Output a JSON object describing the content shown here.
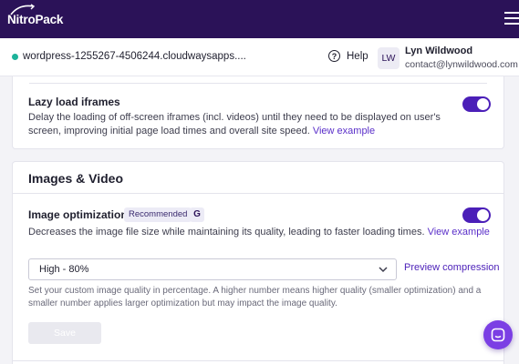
{
  "app": {
    "logo_text": "NitroPack"
  },
  "site": {
    "name": "wordpress-1255267-4506244.cloudwaysapps...."
  },
  "header": {
    "help_label": "Help"
  },
  "user": {
    "initials": "LW",
    "name": "Lyn Wildwood",
    "email": "contact@lynwildwood.com"
  },
  "lazy_iframes": {
    "title": "Lazy load iframes",
    "description": "Delay the loading of off-screen iframes (incl. videos) until they need to be displayed on user's screen, improving initial page load times and overall site speed.",
    "link": "View example",
    "enabled": true
  },
  "images_video": {
    "section_title": "Images & Video",
    "image_optimization": {
      "title": "Image optimization",
      "badge": "Recommended",
      "badge_icon": "G",
      "description": "Decreases the image file size while maintaining its quality, leading to faster loading times.",
      "link": "View example",
      "enabled": true,
      "quality_select_value": "High - 80%",
      "preview_link": "Preview compression",
      "help_text": "Set your custom image quality in percentage. A higher number means higher quality (smaller optimization) and a smaller number applies larger optimization but may impact the image quality.",
      "save_label": "Save"
    }
  },
  "colors": {
    "brand_dark": "#2b1258",
    "accent": "#4b1fb8",
    "chat": "#7b3fe4",
    "status_online": "#1cb39a"
  },
  "icons": {
    "help": "question-circle-icon",
    "menu": "hamburger-icon",
    "chat": "chat-bubble-icon",
    "dropdown": "chevron-down-icon"
  }
}
